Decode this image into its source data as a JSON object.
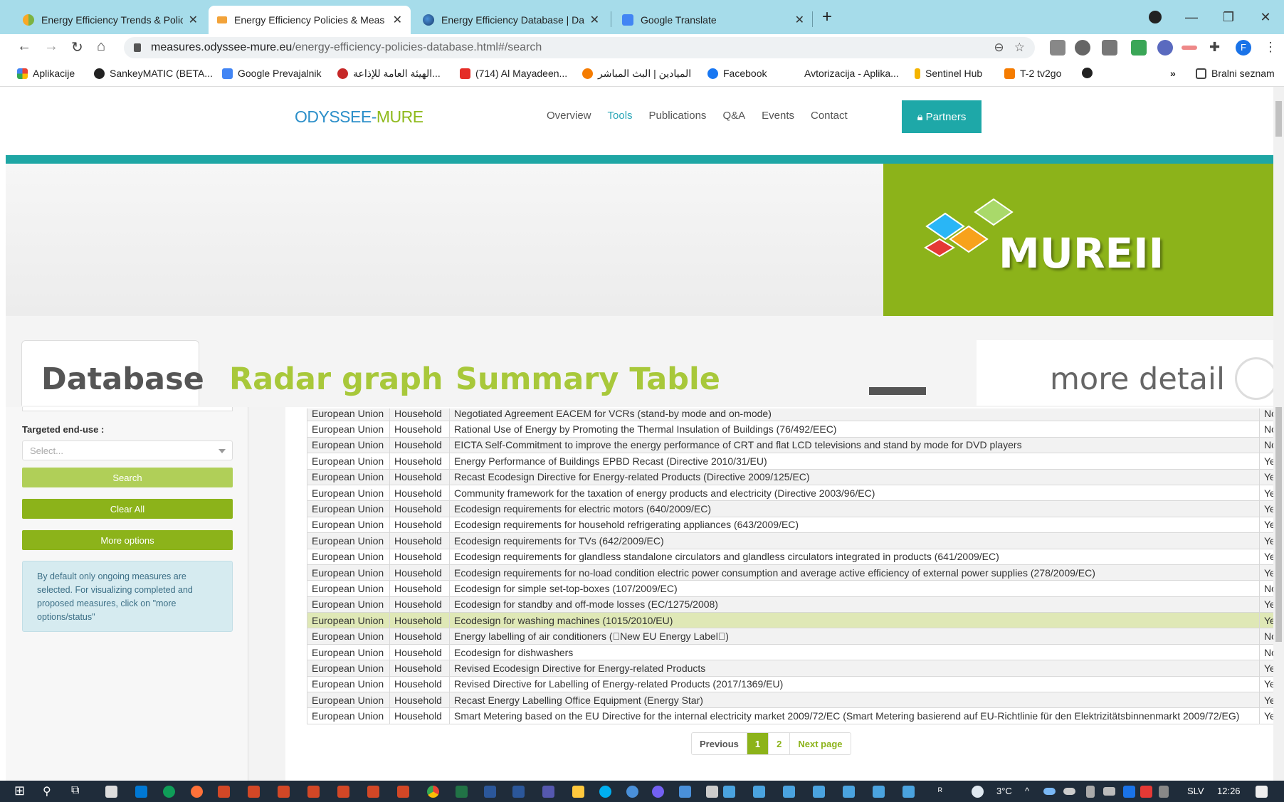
{
  "browser": {
    "tabs": [
      {
        "title": "Energy Efficiency Trends & Policie",
        "active": false
      },
      {
        "title": "Energy Efficiency Policies & Meas",
        "active": true
      },
      {
        "title": "Energy Efficiency Database | Data",
        "active": false
      },
      {
        "title": "Google Translate",
        "active": false
      }
    ],
    "new_tab": "+",
    "url_host": "measures.odyssee-mure.eu",
    "url_path": "/energy-efficiency-policies-database.html#/search",
    "bookmarks": [
      "Aplikacije",
      "SankeyMATIC (BETA...",
      "Google Prevajalnik",
      "الهيئة العامة للإذاعة...",
      "(714) Al Mayadeen...",
      "الميادين | البث المباشر",
      "Facebook",
      "Avtorizacija - Aplika...",
      "Sentinel Hub",
      "T-2 tv2go"
    ],
    "bookmarks_more": "»",
    "reading_list": "Bralni seznam",
    "profile_initial": "F"
  },
  "site": {
    "logo_a": "ODYSSEE",
    "logo_sep": "-",
    "logo_b": "MURE",
    "nav": [
      "Overview",
      "Tools",
      "Publications",
      "Q&A",
      "Events",
      "Contact"
    ],
    "partners": "Partners",
    "banner_logo_text": "MUREII",
    "tabs": {
      "database": "Database",
      "radar": "Radar graph",
      "summary": "Summary Table"
    },
    "more_detail": "more detail"
  },
  "filters": {
    "end_use_label": "Targeted end-use :",
    "end_use_placeholder": "Select...",
    "search": "Search",
    "clear": "Clear All",
    "more_options": "More options",
    "info": "By default only ongoing measures are selected. For visualizing completed and proposed measures, click on \"more options/status\""
  },
  "table": {
    "rows": [
      [
        "European Union",
        "Household",
        "Negotiated Agreement EACEM for VCRs (stand-by mode and on-mode)",
        "No"
      ],
      [
        "European Union",
        "Household",
        "Rational Use of Energy by Promoting the Thermal Insulation of Buildings (76/492/EEC)",
        "No"
      ],
      [
        "European Union",
        "Household",
        "EICTA Self-Commitment to improve the energy performance of CRT and flat LCD televisions and stand by mode for DVD players",
        "No"
      ],
      [
        "European Union",
        "Household",
        "Energy Performance of Buildings EPBD Recast (Directive 2010/31/EU)",
        "Ye"
      ],
      [
        "European Union",
        "Household",
        "Recast Ecodesign Directive for Energy-related Products (Directive 2009/125/EC)",
        "Ye"
      ],
      [
        "European Union",
        "Household",
        "Community framework for the taxation of energy products and electricity (Directive 2003/96/EC)",
        "Ye"
      ],
      [
        "European Union",
        "Household",
        "Ecodesign requirements for electric motors (640/2009/EC)",
        "Ye"
      ],
      [
        "European Union",
        "Household",
        "Ecodesign requirements for household refrigerating appliances (643/2009/EC)",
        "Ye"
      ],
      [
        "European Union",
        "Household",
        "Ecodesign requirements for TVs (642/2009/EC)",
        "Ye"
      ],
      [
        "European Union",
        "Household",
        "Ecodesign requirements for glandless standalone circulators and glandless circulators integrated in products (641/2009/EC)",
        "Ye"
      ],
      [
        "European Union",
        "Household",
        "Ecodesign requirements for no-load condition electric power consumption and average active efficiency of external power supplies (278/2009/EC)",
        "Ye"
      ],
      [
        "European Union",
        "Household",
        "Ecodesign for simple set-top-boxes (107/2009/EC)",
        "No"
      ],
      [
        "European Union",
        "Household",
        "Ecodesign for standby and off-mode losses (EC/1275/2008)",
        "Ye"
      ],
      [
        "European Union",
        "Household",
        "Ecodesign for washing machines (1015/2010/EU)",
        "Ye"
      ],
      [
        "European Union",
        "Household",
        "Energy labelling of air conditioners (\u0000New EU Energy Label\u0000)",
        "No"
      ],
      [
        "European Union",
        "Household",
        "Ecodesign for dishwashers",
        "No"
      ],
      [
        "European Union",
        "Household",
        "Revised Ecodesign Directive for Energy-related Products",
        "Ye"
      ],
      [
        "European Union",
        "Household",
        "Revised Directive for Labelling of Energy-related Products (2017/1369/EU)",
        "Ye"
      ],
      [
        "European Union",
        "Household",
        "Recast Energy Labelling Office Equipment (Energy Star)",
        "Ye"
      ],
      [
        "European Union",
        "Household",
        "Smart Metering based on the EU Directive for the internal electricity market 2009/72/EC (Smart Metering basierend auf EU-Richtlinie für den Elektrizitätsbinnenmarkt 2009/72/EG)",
        "Ye"
      ]
    ],
    "highlight_row": 13
  },
  "pager": {
    "prev": "Previous",
    "page1": "1",
    "page2": "2",
    "next": "Next page"
  },
  "taskbar": {
    "weather": "3°C",
    "lang": "SLV",
    "time": "12:26"
  },
  "colors": {
    "accent_green": "#8cb31a",
    "teal": "#1ea6a4",
    "tab_strip": "#a6dcea"
  }
}
